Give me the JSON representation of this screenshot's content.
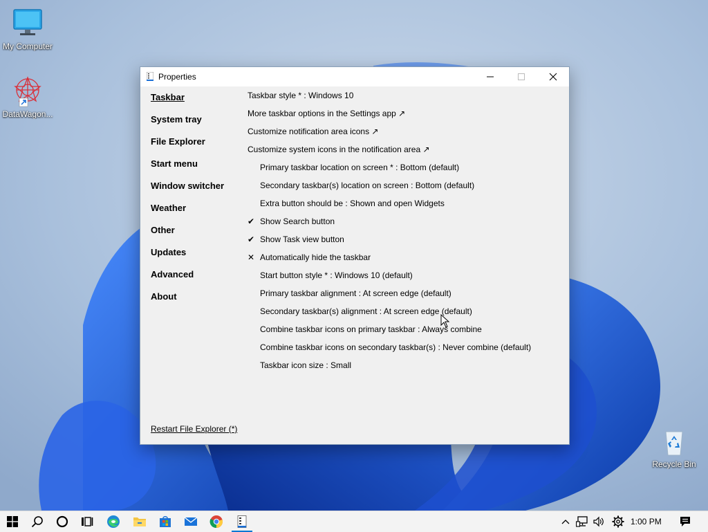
{
  "desktop": {
    "icons": [
      {
        "label": "My Computer",
        "icon": "monitor-icon"
      },
      {
        "label": "DataWagon...",
        "icon": "datawagon-app-icon"
      },
      {
        "label": "Recycle Bin",
        "icon": "recycle-bin-icon"
      }
    ]
  },
  "window": {
    "title": "Properties",
    "nav": [
      {
        "label": "Taskbar",
        "active": true
      },
      {
        "label": "System tray"
      },
      {
        "label": "File Explorer"
      },
      {
        "label": "Start menu"
      },
      {
        "label": "Window switcher"
      },
      {
        "label": "Weather"
      },
      {
        "label": "Other"
      },
      {
        "label": "Updates"
      },
      {
        "label": "Advanced"
      },
      {
        "label": "About"
      }
    ],
    "settings": [
      {
        "text": "Taskbar style * : Windows 10",
        "indent": false,
        "mark": ""
      },
      {
        "text": "More taskbar options in the Settings app ↗",
        "indent": false,
        "mark": ""
      },
      {
        "text": "Customize notification area icons ↗",
        "indent": false,
        "mark": ""
      },
      {
        "text": "Customize system icons in the notification area ↗",
        "indent": false,
        "mark": ""
      },
      {
        "text": "Primary taskbar location on screen * : Bottom (default)",
        "indent": true,
        "mark": ""
      },
      {
        "text": "Secondary taskbar(s) location on screen : Bottom (default)",
        "indent": true,
        "mark": ""
      },
      {
        "text": "Extra button should be : Shown and open Widgets",
        "indent": true,
        "mark": ""
      },
      {
        "text": "Show Search button",
        "indent": true,
        "mark": "✔"
      },
      {
        "text": "Show Task view button",
        "indent": true,
        "mark": "✔"
      },
      {
        "text": "Automatically hide the taskbar",
        "indent": true,
        "mark": "✕"
      },
      {
        "text": "Start button style * : Windows 10 (default)",
        "indent": true,
        "mark": ""
      },
      {
        "text": "Primary taskbar alignment : At screen edge (default)",
        "indent": true,
        "mark": ""
      },
      {
        "text": "Secondary taskbar(s) alignment : At screen edge (default)",
        "indent": true,
        "mark": ""
      },
      {
        "text": "Combine taskbar icons on primary taskbar : Always combine",
        "indent": true,
        "mark": ""
      },
      {
        "text": "Combine taskbar icons on secondary taskbar(s) : Never combine (default)",
        "indent": true,
        "mark": ""
      },
      {
        "text": "Taskbar icon size : Small",
        "indent": true,
        "mark": ""
      }
    ],
    "restart_link": "Restart File Explorer (*)"
  },
  "taskbar": {
    "apps": [
      "start-icon",
      "search-icon",
      "cortana-icon",
      "task-view-icon",
      "edge-icon",
      "file-explorer-icon",
      "store-icon",
      "mail-icon",
      "chrome-icon",
      "properties-app-icon"
    ],
    "tray": [
      "chevron-up-icon",
      "network-icon",
      "volume-icon",
      "settings-gear-icon"
    ],
    "clock": "1:00 PM",
    "notification": "notification-icon"
  },
  "colors": {
    "accent": "#0078d4",
    "wallpaper": "#a9c0dc",
    "bloom": "#1a56d6"
  }
}
